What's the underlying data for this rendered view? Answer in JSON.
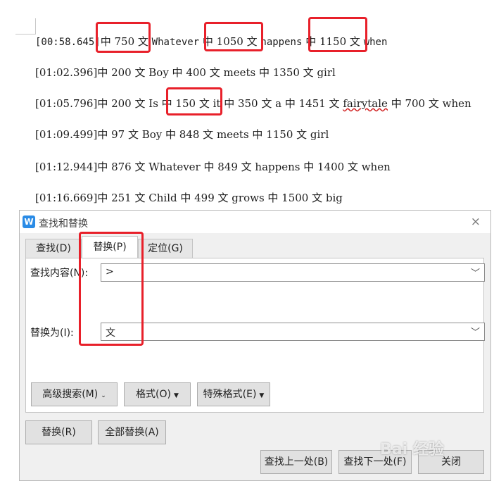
{
  "document": {
    "lines": [
      {
        "parts": [
          "[00:58.645]",
          "中 750 文",
          "Whatever",
          "中 1050 文",
          "happens",
          "中 1150 文",
          "when"
        ]
      },
      {
        "text": "[01:02.396]中 200 文 Boy 中 400 文 meets 中 1350 文 girl"
      },
      {
        "parts": [
          "[01:05.796]中 200 文 Is ",
          "中 150 文",
          "it 中 350 文 a 中 1451 文 ",
          "fairytale",
          " 中 700 文 when"
        ]
      },
      {
        "text": "[01:09.499]中 97 文 Boy 中 848 文 meets 中 1150 文 girl"
      },
      {
        "text": "[01:12.944]中 876 文 Whatever 中 849 文 happens 中 1400 文 when"
      },
      {
        "text": "[01:16.669]中 251 文 Child 中 499 文 grows 中 1500 文 big"
      }
    ]
  },
  "dialog": {
    "title": "查找和替换",
    "app_icon": "W",
    "close_icon": "×",
    "tabs": [
      {
        "label": "查找(D)"
      },
      {
        "label": "替换(P)",
        "active": true
      },
      {
        "label": "定位(G)"
      }
    ],
    "find": {
      "label": "查找内容(N):",
      "value": ">"
    },
    "replace": {
      "label": "替换为(I):",
      "value": "文"
    },
    "option_buttons": [
      "高级搜索(M)",
      "格式(O)",
      "特殊格式(E)"
    ],
    "action_buttons": [
      "替换(R)",
      "全部替换(A)"
    ],
    "bottom_buttons": [
      "查找上一处(B)",
      "查找下一处(F)",
      "关闭"
    ]
  },
  "watermark": "Bai 经验",
  "colors": {
    "highlight_box": "#e8202a",
    "accent": "#2a8be6"
  }
}
